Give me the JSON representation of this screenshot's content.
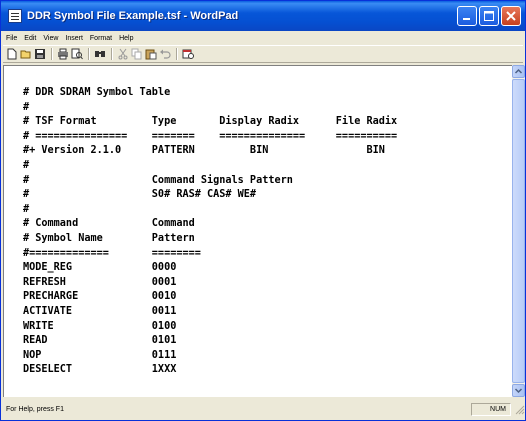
{
  "window": {
    "title": "DDR Symbol File Example.tsf - WordPad"
  },
  "menu": {
    "items": [
      "File",
      "Edit",
      "View",
      "Insert",
      "Format",
      "Help"
    ]
  },
  "toolbar": {
    "tools": [
      "new-icon",
      "open-icon",
      "save-icon",
      "print-icon",
      "print-preview-icon",
      "find-icon",
      "cut-icon",
      "copy-icon",
      "paste-icon",
      "undo-icon",
      "date-time-icon"
    ]
  },
  "document": {
    "lines": [
      "# DDR SDRAM Symbol Table",
      "#",
      "# TSF Format         Type       Display Radix      File Radix",
      "# ===============    =======    ==============     ==========",
      "#+ Version 2.1.0     PATTERN         BIN                BIN",
      "#",
      "#                    Command Signals Pattern",
      "#                    S0# RAS# CAS# WE#",
      "#",
      "# Command            Command",
      "# Symbol Name        Pattern",
      "#=============       ========",
      "MODE_REG             0000",
      "REFRESH              0001",
      "PRECHARGE            0010",
      "ACTIVATE             0011",
      "WRITE                0100",
      "READ                 0101",
      "NOP                  0111",
      "DESELECT             1XXX"
    ]
  },
  "status": {
    "help_text": "For Help, press F1",
    "num_indicator": "NUM"
  },
  "colors": {
    "titlebar": "#0756d8",
    "chrome": "#ece9d8",
    "close_button": "#c6401e"
  }
}
